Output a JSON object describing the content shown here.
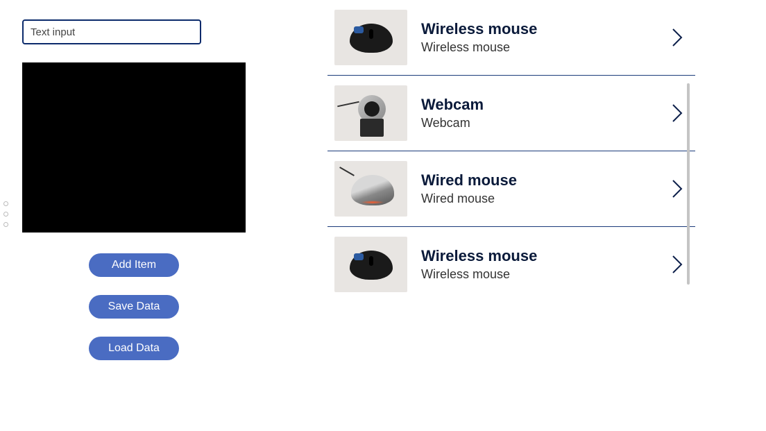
{
  "input": {
    "placeholder": "Text input",
    "value": ""
  },
  "buttons": {
    "add": "Add Item",
    "save": "Save Data",
    "load": "Load Data"
  },
  "items": [
    {
      "title": "Wireless mouse",
      "subtitle": "Wireless mouse",
      "thumb_type": "wireless-mouse"
    },
    {
      "title": "Webcam",
      "subtitle": "Webcam",
      "thumb_type": "webcam"
    },
    {
      "title": "Wired mouse",
      "subtitle": "Wired mouse",
      "thumb_type": "wired-mouse"
    },
    {
      "title": "Wireless mouse",
      "subtitle": "Wireless mouse",
      "thumb_type": "wireless-mouse"
    }
  ],
  "colors": {
    "accent": "#4a6cc2",
    "border_dark": "#0b2a6b",
    "divider": "#1a3a7a"
  }
}
